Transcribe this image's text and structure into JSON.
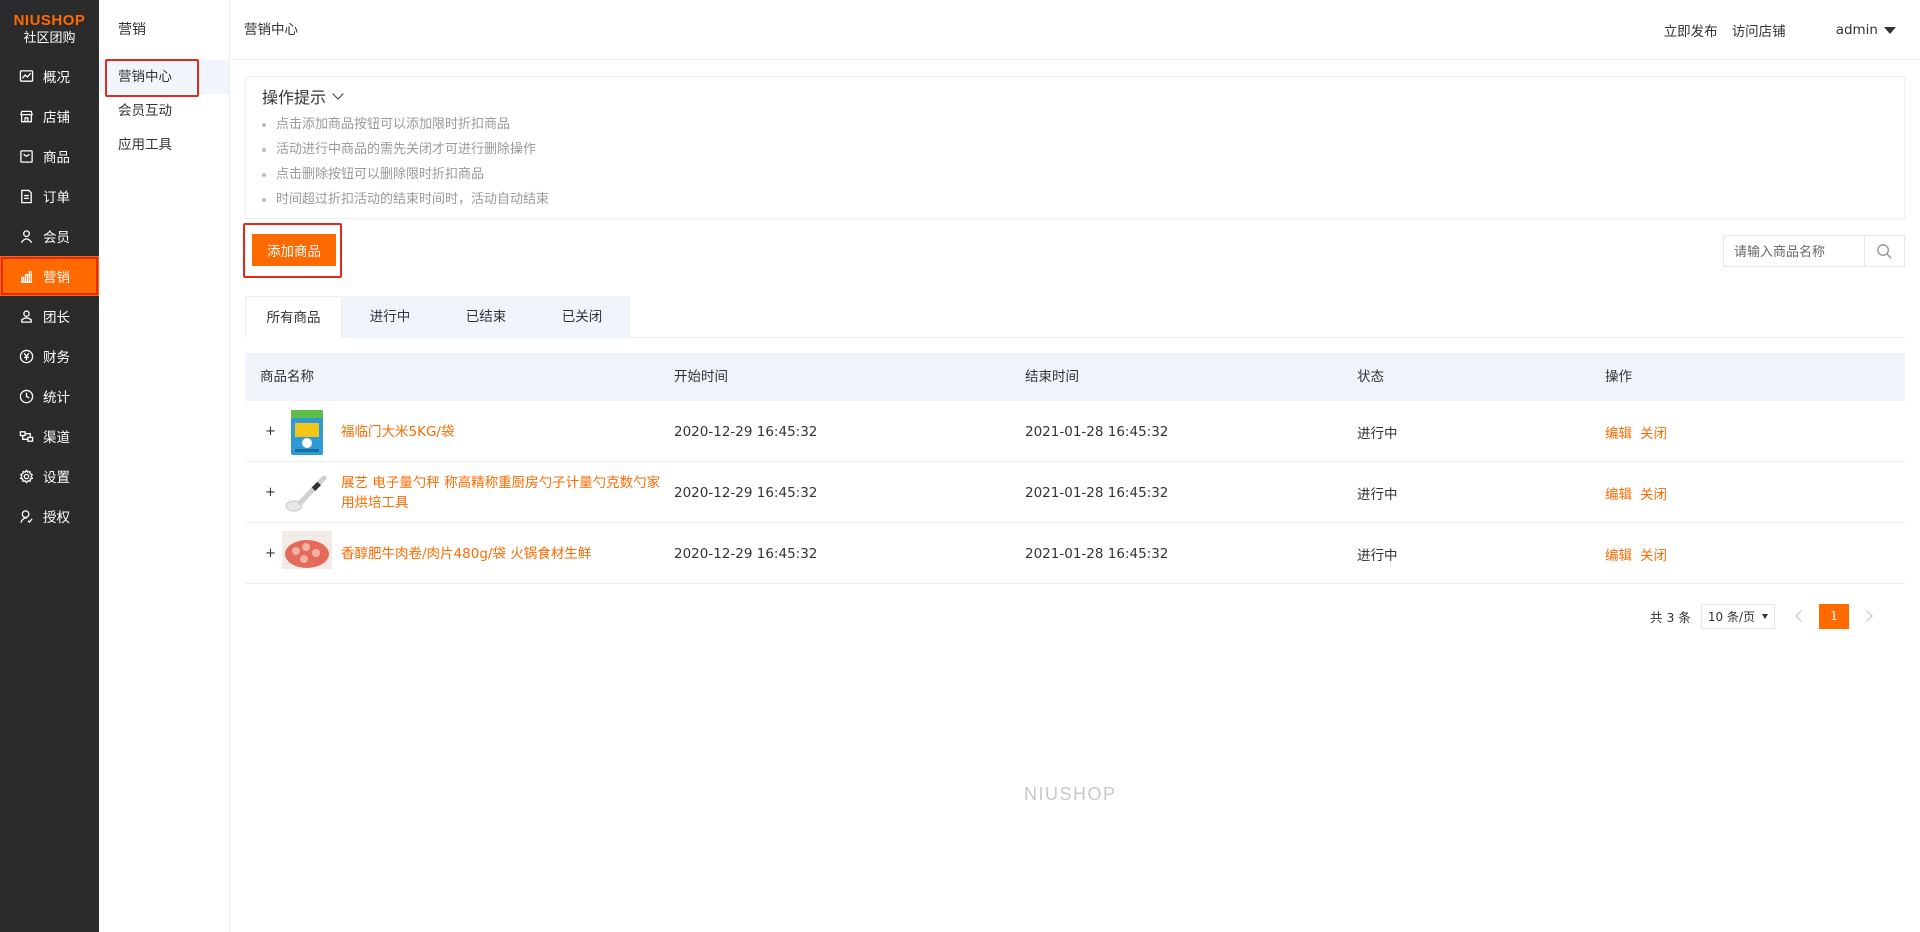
{
  "logo": {
    "brand": "NIUSHOP",
    "sub": "社区团购"
  },
  "sidebar": {
    "items": [
      {
        "label": "概况",
        "icon": "chart-icon"
      },
      {
        "label": "店铺",
        "icon": "store-icon"
      },
      {
        "label": "商品",
        "icon": "goods-icon"
      },
      {
        "label": "订单",
        "icon": "order-icon"
      },
      {
        "label": "会员",
        "icon": "member-icon"
      },
      {
        "label": "营销",
        "icon": "marketing-icon",
        "active": true
      },
      {
        "label": "团长",
        "icon": "leader-icon"
      },
      {
        "label": "财务",
        "icon": "finance-icon"
      },
      {
        "label": "统计",
        "icon": "stats-icon"
      },
      {
        "label": "渠道",
        "icon": "channel-icon"
      },
      {
        "label": "设置",
        "icon": "settings-icon"
      },
      {
        "label": "授权",
        "icon": "auth-icon"
      }
    ]
  },
  "submenu": {
    "title": "营销",
    "items": [
      {
        "label": "营销中心",
        "active": true
      },
      {
        "label": "会员互动"
      },
      {
        "label": "应用工具"
      }
    ]
  },
  "header": {
    "breadcrumb": "营销中心",
    "links": [
      "立即发布",
      "访问店铺"
    ],
    "user": "admin"
  },
  "tips": {
    "title": "操作提示",
    "items": [
      "点击添加商品按钮可以添加限时折扣商品",
      "活动进行中商品的需先关闭才可进行删除操作",
      "点击删除按钮可以删除限时折扣商品",
      "时间超过折扣活动的结束时间时，活动自动结束"
    ]
  },
  "toolbar": {
    "add_label": "添加商品"
  },
  "search": {
    "placeholder": "请输入商品名称",
    "value": ""
  },
  "tabs": [
    "所有商品",
    "进行中",
    "已结束",
    "已关闭"
  ],
  "table": {
    "columns": [
      "商品名称",
      "开始时间",
      "结束时间",
      "状态",
      "操作"
    ],
    "rows": [
      {
        "name": "福临门大米5KG/袋",
        "start": "2020-12-29 16:45:32",
        "end": "2021-01-28 16:45:32",
        "status": "进行中",
        "ops": [
          "编辑",
          "关闭"
        ]
      },
      {
        "name": "展艺 电子量勺秤 称高精称重厨房勺子计量勺克数勺家用烘培工具",
        "start": "2020-12-29 16:45:32",
        "end": "2021-01-28 16:45:32",
        "status": "进行中",
        "ops": [
          "编辑",
          "关闭"
        ]
      },
      {
        "name": "香醇肥牛肉卷/肉片480g/袋 火锅食材生鲜",
        "start": "2020-12-29 16:45:32",
        "end": "2021-01-28 16:45:32",
        "status": "进行中",
        "ops": [
          "编辑",
          "关闭"
        ]
      }
    ],
    "expand_symbol": "+"
  },
  "pagination": {
    "total": "共 3 条",
    "page_size": "10 条/页",
    "current": "1"
  },
  "footer": {
    "brand": "NIUSHOP"
  },
  "colors": {
    "accent": "#ff6a00",
    "sidebar_bg": "#2b2b2b",
    "highlight_border": "#e6281b",
    "table_head_bg": "#eef4fa"
  }
}
